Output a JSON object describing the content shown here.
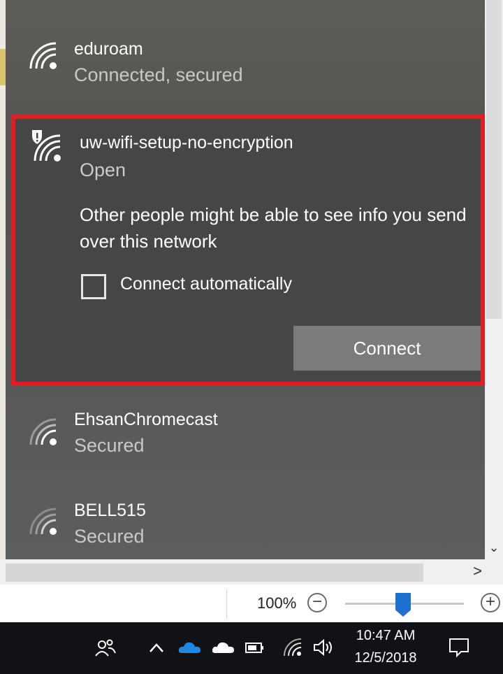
{
  "networks": [
    {
      "name": "eduroam",
      "status": "Connected, secured",
      "icon": "wifi-icon"
    },
    {
      "name": "uw-wifi-setup-no-encryption",
      "status": "Open",
      "icon": "wifi-warning-icon"
    },
    {
      "name": "EhsanChromecast",
      "status": "Secured",
      "icon": "wifi-icon"
    },
    {
      "name": "BELL515",
      "status": "Secured",
      "icon": "wifi-icon"
    }
  ],
  "expanded": {
    "warning": "Other people might be able to see info you send over this network",
    "auto_connect_label": "Connect automatically",
    "auto_connect_checked": false,
    "connect_label": "Connect",
    "highlight_color": "#e01e24"
  },
  "zoom": {
    "level_text": "100%",
    "minus": "−",
    "plus": "+"
  },
  "taskbar": {
    "time": "10:47 AM",
    "date": "12/5/2018",
    "icons": [
      "people-icon",
      "chevron-up-icon",
      "onedrive-blue-icon",
      "onedrive-white-icon",
      "battery-icon",
      "wifi-icon",
      "volume-icon",
      "action-center-icon"
    ]
  },
  "scroll": {
    "down_arrow": "⌄",
    "right_arrow": ">"
  }
}
